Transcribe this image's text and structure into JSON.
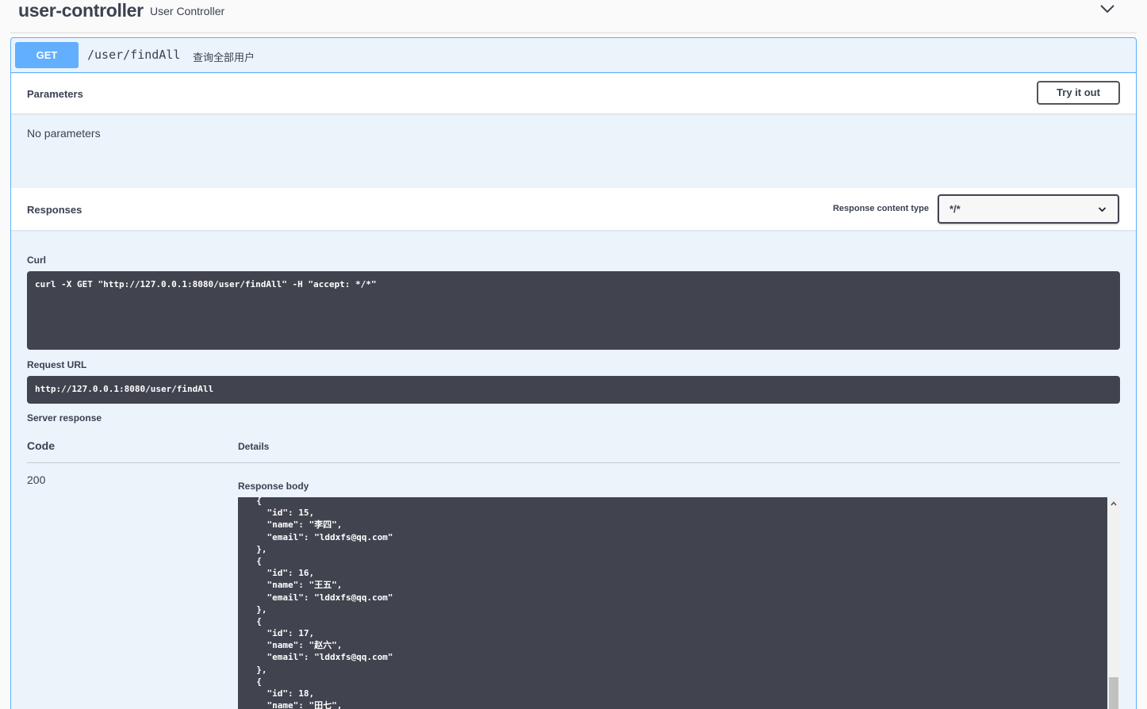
{
  "tag": {
    "name": "user-controller",
    "description": "User Controller",
    "toggle_icon": "chevron-down-icon"
  },
  "operation": {
    "method": "GET",
    "path": "/user/findAll",
    "summary": "查询全部用户",
    "method_color": "#61affe"
  },
  "parameters": {
    "title": "Parameters",
    "try_button": "Try it out",
    "empty_text": "No parameters"
  },
  "responses": {
    "title": "Responses",
    "content_type_label": "Response content type",
    "content_type_value": "*/*"
  },
  "curl": {
    "label": "Curl",
    "command": "curl -X GET \"http://127.0.0.1:8080/user/findAll\" -H \"accept: */*\""
  },
  "request_url": {
    "label": "Request URL",
    "value": "http://127.0.0.1:8080/user/findAll"
  },
  "server_response": {
    "label": "Server response",
    "code_header": "Code",
    "details_header": "Details",
    "code": "200",
    "body_label": "Response body",
    "body_lines": [
      "  {",
      "    \"id\": 15,",
      "    \"name\": \"李四\",",
      "    \"email\": \"lddxfs@qq.com\"",
      "  },",
      "  {",
      "    \"id\": 16,",
      "    \"name\": \"王五\",",
      "    \"email\": \"lddxfs@qq.com\"",
      "  },",
      "  {",
      "    \"id\": 17,",
      "    \"name\": \"赵六\",",
      "    \"email\": \"lddxfs@qq.com\"",
      "  },",
      "  {",
      "    \"id\": 18,",
      "    \"name\": \"田七\","
    ]
  }
}
